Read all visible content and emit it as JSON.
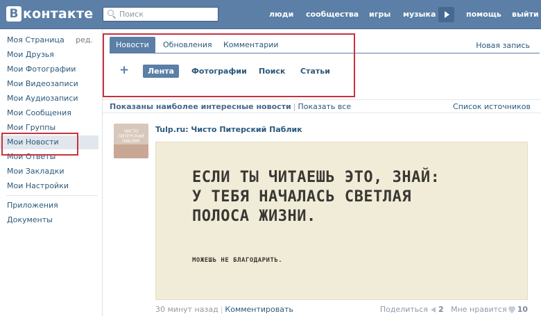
{
  "header": {
    "logo_letter": "В",
    "logo_text": "контакте",
    "search_placeholder": "Поиск",
    "nav": [
      "люди",
      "сообщества",
      "игры",
      "музыка",
      "помощь",
      "выйти"
    ]
  },
  "sidebar": {
    "edit_label": "ред.",
    "items": [
      "Моя Страница",
      "Мои Друзья",
      "Мои Фотографии",
      "Мои Видеозаписи",
      "Мои Аудиозаписи",
      "Мои Сообщения",
      "Мои Группы",
      "Мои Новости",
      "Мои Ответы",
      "Мои Закладки",
      "Мои Настройки"
    ],
    "active_item": "Мои Новости",
    "extra": [
      "Приложения",
      "Документы"
    ]
  },
  "main": {
    "tabs": [
      "Новости",
      "Обновления",
      "Комментарии"
    ],
    "active_tab": "Новости",
    "new_post": "Новая запись",
    "plus": "+",
    "filters": [
      "Лента",
      "Фотографии",
      "Поиск",
      "Статьи"
    ],
    "active_filter": "Лента",
    "info": {
      "shown": "Показаны наиболее интересные новости",
      "separator": "|",
      "show_all": "Показать все",
      "sources": "Список источников"
    }
  },
  "post": {
    "avatar_text": "ЧИСТО ПИТЕРСКИЙ ПАБЛИК",
    "author": "Tulp.ru: Чисто Питерский Паблик",
    "image_lines": [
      "ЕСЛИ ТЫ ЧИТАЕШЬ ЭТО, ЗНАЙ:",
      "У ТЕБЯ НАЧАЛАСЬ СВЕТЛАЯ",
      "ПОЛОСА ЖИЗНИ."
    ],
    "image_small": "МОЖЕШЬ НЕ БЛАГОДАРИТЬ.",
    "time": "30 минут назад",
    "separator": "|",
    "comment": "Комментировать",
    "share_label": "Поделиться",
    "share_count": "2",
    "dislike_label": "Мне нравится",
    "like_count": "10"
  },
  "colors": {
    "header_bg": "#5b7fa6",
    "link": "#2b587a",
    "highlight_red": "#c9303c",
    "poster_bg": "#f1ecd8"
  }
}
